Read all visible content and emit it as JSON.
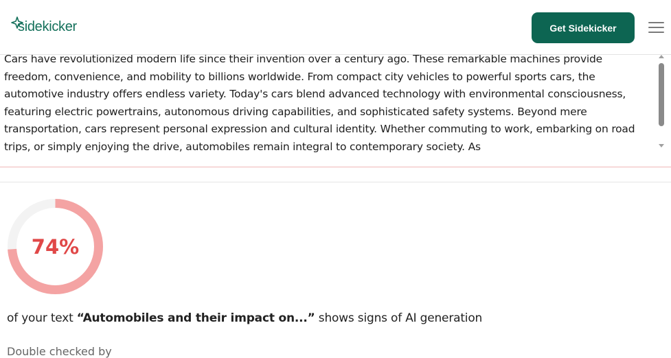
{
  "header": {
    "logo_text": "sidekicker",
    "cta_label": "Get Sidekicker",
    "menu_icon": "hamburger-icon",
    "brand_color": "#0d6552"
  },
  "input_text": "Cars have revolutionized modern life since their invention over a century ago. These remarkable machines provide freedom, convenience, and mobility to billions worldwide. From compact city vehicles to powerful sports cars, the automotive industry offers endless variety. Today's cars blend advanced technology with environmental consciousness, featuring electric powertrains, autonomous driving capabilities, and sophisticated safety systems. Beyond mere transportation, cars represent personal expression and cultural identity. Whether commuting to work, embarking on road trips, or simply enjoying the drive, automobiles remain integral to contemporary society. As",
  "result": {
    "percent": 74,
    "percent_label": "74%",
    "gauge_color": "#f4a3a3",
    "track_color": "#f3f3f3",
    "value_color": "#e04848",
    "prefix": "of your text ",
    "quote": "“Automobiles and their impact on...”",
    "suffix": " shows signs of AI generation"
  },
  "double_checked_label": "Double checked by"
}
